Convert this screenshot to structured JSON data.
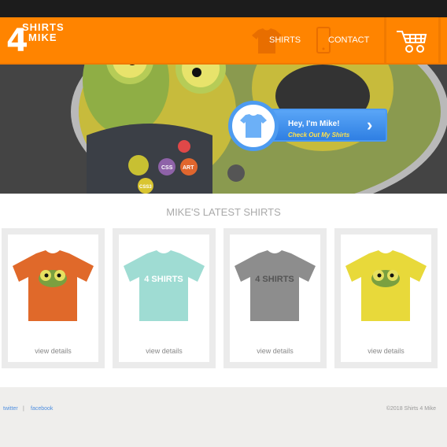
{
  "header": {
    "logo_line1": "SHIRTS",
    "logo_number": "4",
    "logo_line2": "MIKE",
    "nav": [
      {
        "label": "SHIRTS",
        "icon": "shirt-icon"
      },
      {
        "label": "CONTACT",
        "icon": "phone-icon"
      }
    ],
    "cart_icon": "cart-icon",
    "color": "#ff8400"
  },
  "hero": {
    "greeting": "Hey, I'm Mike!",
    "cta": "Check Out My Shirts",
    "badges": [
      "CSS",
      "ART",
      "CSS3"
    ]
  },
  "section_title": "MIKE'S LATEST SHIRTS",
  "products": [
    {
      "color": "#e0692a",
      "design": "frog",
      "link": "view details"
    },
    {
      "color": "#9fdcd3",
      "design": "logo",
      "link": "view details"
    },
    {
      "color": "#8d8d8d",
      "design": "logo",
      "link": "view details"
    },
    {
      "color": "#e8d93a",
      "design": "frog",
      "link": "view details"
    }
  ],
  "footer": {
    "links": [
      "twitter",
      "facebook"
    ],
    "separator": "|",
    "copyright": "©2018 Shirts 4 Mike"
  }
}
